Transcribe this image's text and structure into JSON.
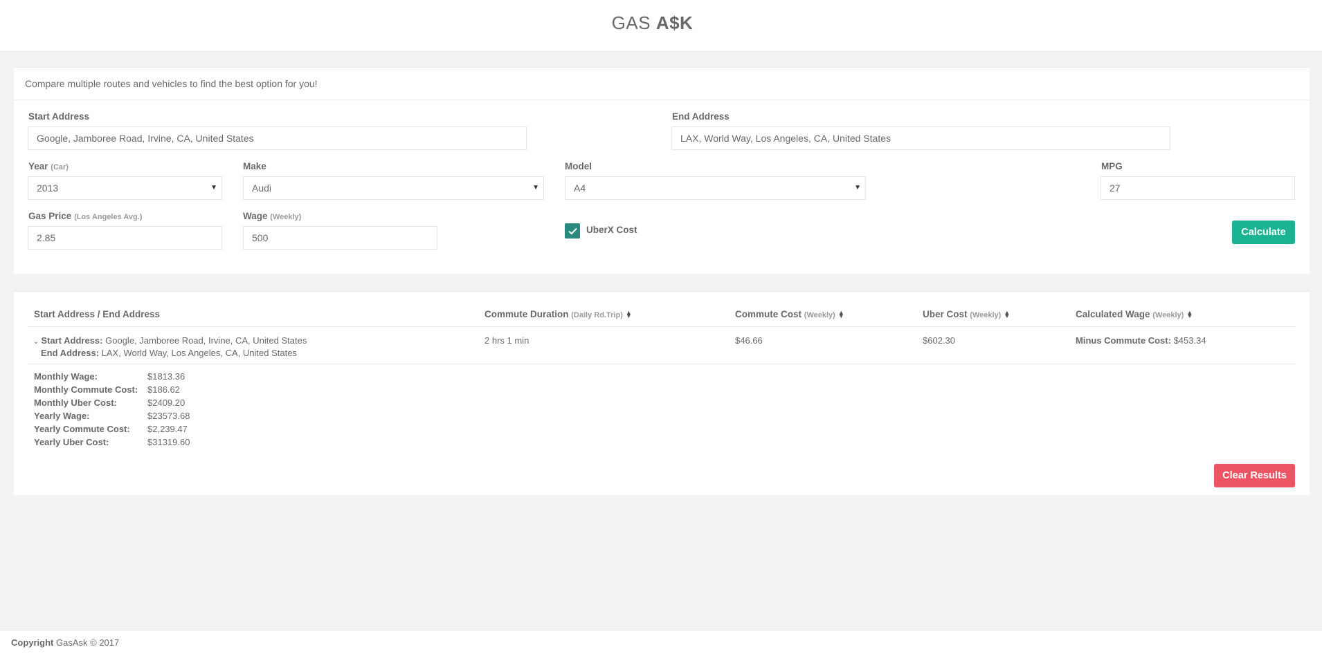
{
  "brand": {
    "light": "GAS",
    "bold": "A$K"
  },
  "form": {
    "header": "Compare multiple routes and vehicles to find the best option for you!",
    "start_label": "Start Address",
    "start_value": "Google, Jamboree Road, Irvine, CA, United States",
    "end_label": "End Address",
    "end_value": "LAX, World Way, Los Angeles, CA, United States",
    "year_label": "Year",
    "year_sub": "(Car)",
    "year_value": "2013",
    "make_label": "Make",
    "make_value": "Audi",
    "model_label": "Model",
    "model_value": "A4",
    "mpg_label": "MPG",
    "mpg_value": "27",
    "gas_label": "Gas Price",
    "gas_sub": "(Los Angeles Avg.)",
    "gas_value": "2.85",
    "wage_label": "Wage",
    "wage_sub": "(Weekly)",
    "wage_value": "500",
    "uber_label": "UberX Cost",
    "uber_checked": true,
    "calculate_label": "Calculate"
  },
  "results": {
    "headers": {
      "address": "Start Address / End Address",
      "duration": "Commute Duration",
      "duration_sub": "(Daily Rd.Trip)",
      "cost": "Commute Cost",
      "cost_sub": "(Weekly)",
      "uber": "Uber Cost",
      "uber_sub": "(Weekly)",
      "wage": "Calculated Wage",
      "wage_sub": "(Weekly)"
    },
    "row": {
      "start_key": "Start Address:",
      "start_val": "Google, Jamboree Road, Irvine, CA, United States",
      "end_key": "End Address:",
      "end_val": "LAX, World Way, Los Angeles, CA, United States",
      "duration": "2 hrs 1 min",
      "cost": "$46.66",
      "uber": "$602.30",
      "wage_key": "Minus Commute Cost:",
      "wage_val": "$453.34"
    },
    "summary": [
      {
        "key": "Monthly Wage:",
        "val": "$1813.36"
      },
      {
        "key": "Monthly Commute Cost:",
        "val": "$186.62"
      },
      {
        "key": "Monthly Uber Cost:",
        "val": "$2409.20"
      },
      {
        "key": "Yearly Wage:",
        "val": "$23573.68"
      },
      {
        "key": "Yearly Commute Cost:",
        "val": "$2,239.47"
      },
      {
        "key": "Yearly Uber Cost:",
        "val": "$31319.60"
      }
    ],
    "clear_label": "Clear Results"
  },
  "footer": {
    "bold": "Copyright",
    "text": "GasAsk © 2017"
  },
  "colors": {
    "primary": "#1ab394",
    "danger": "#ed5565",
    "checkbox": "#2a8a7e"
  }
}
